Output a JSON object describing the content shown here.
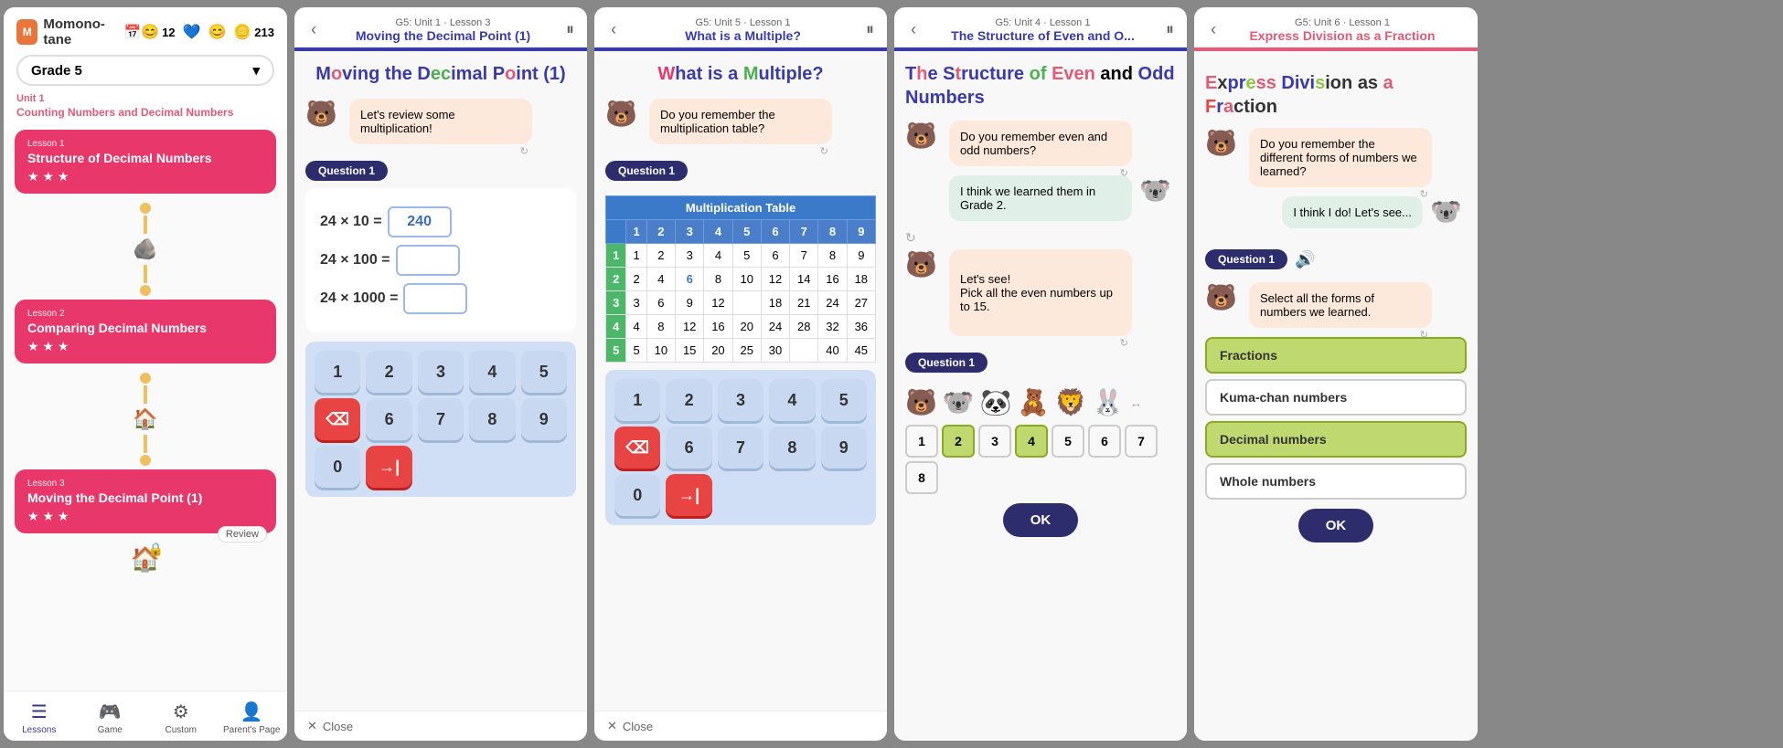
{
  "panel1": {
    "logo": "Momono-tane",
    "coins": [
      {
        "emoji": "😊",
        "value": "12"
      },
      {
        "emoji": "💙",
        "value": ""
      },
      {
        "emoji": "😊",
        "value": ""
      },
      {
        "emoji": "🌟",
        "value": "213"
      }
    ],
    "grade": "Grade 5",
    "unit_number": "Unit 1",
    "unit_title": "Counting Numbers and Decimal Numbers",
    "lessons": [
      {
        "label": "Lesson 1",
        "title": "Structure of Decimal Numbers",
        "stars": "★ ★ ★"
      },
      {
        "label": "Lesson 2",
        "title": "Comparing Decimal Numbers",
        "stars": "★ ★ ★"
      },
      {
        "label": "Lesson 3",
        "title": "Moving the Decimal Point (1)",
        "stars": "★ ★ ★"
      }
    ],
    "nav": [
      {
        "label": "Lessons",
        "icon": "☰",
        "active": true
      },
      {
        "label": "Game",
        "icon": "🎮",
        "active": false
      },
      {
        "label": "Custom",
        "icon": "⚙",
        "active": false
      },
      {
        "label": "Parent's Page",
        "icon": "👤",
        "active": false
      }
    ]
  },
  "panel2": {
    "grade_label": "G5: Unit 1 · Lesson 3",
    "lesson_title": "Moving the Decimal Point (1)",
    "main_title": "Moving the Decimal Point (1)",
    "chat_bubble": "Let's review some multiplication!",
    "question_label": "Question 1",
    "problems": [
      {
        "left": "24 × 10 =",
        "answer": "240",
        "filled": true
      },
      {
        "left": "24 × 100 =",
        "answer": "",
        "filled": false
      },
      {
        "left": "24 × 1000 =",
        "answer": "",
        "filled": false
      }
    ],
    "keyboard": [
      "1",
      "2",
      "3",
      "4",
      "5",
      "⌫",
      "6",
      "7",
      "8",
      "9",
      "0",
      "→|"
    ],
    "close_label": "Close"
  },
  "panel3": {
    "grade_label": "G5: Unit 5 · Lesson 1",
    "lesson_title": "What is a Multiple?",
    "main_title": "What is a Multiple?",
    "chat_bubble": "Do you remember the multiplication table?",
    "question_label": "Question 1",
    "table_title": "Multiplication Table",
    "table_headers": [
      "1",
      "2",
      "3",
      "4",
      "5",
      "6",
      "7",
      "8",
      "9"
    ],
    "table_rows": [
      {
        "row_num": "1",
        "cells": [
          "1",
          "2",
          "3",
          "4",
          "5",
          "6",
          "7",
          "8",
          "9"
        ]
      },
      {
        "row_num": "2",
        "cells": [
          "2",
          "4",
          "6",
          "8",
          "10",
          "12",
          "14",
          "16",
          "18"
        ]
      },
      {
        "row_num": "3",
        "cells": [
          "3",
          "6",
          "9",
          "12",
          "",
          "18",
          "21",
          "24",
          "27"
        ]
      },
      {
        "row_num": "4",
        "cells": [
          "4",
          "8",
          "12",
          "16",
          "20",
          "24",
          "28",
          "32",
          "36"
        ]
      },
      {
        "row_num": "5",
        "cells": [
          "5",
          "10",
          "15",
          "20",
          "25",
          "30",
          "",
          "40",
          "45"
        ]
      }
    ],
    "keyboard": [
      "1",
      "2",
      "3",
      "4",
      "5",
      "⌫",
      "6",
      "7",
      "8",
      "9",
      "0",
      "→|"
    ],
    "close_label": "Close"
  },
  "panel4": {
    "grade_label": "G5: Unit 4 · Lesson 1",
    "lesson_title": "The Structure of Even and O...",
    "main_title": "The Structure of Even and Odd Numbers",
    "chat1": "Do you remember even and odd numbers?",
    "chat2": "I think we learned them in Grade 2.",
    "chat3": "Let's see!\nPick all the even numbers up to 15.",
    "question_label": "Question 1",
    "numbers": [
      "1",
      "2",
      "3",
      "4",
      "5",
      "6",
      "7",
      "8"
    ],
    "selected_numbers": [
      2,
      4
    ],
    "ok_label": "OK"
  },
  "panel5": {
    "grade_label": "G5: Unit 6 · Lesson 1",
    "lesson_title": "Express Division as a Fraction",
    "main_title": "Express Division as a Fraction",
    "chat1": "Do you remember the different forms of numbers we learned?",
    "chat2": "I think I do! Let's see...",
    "question_label": "Question 1",
    "question_text": "Select all the forms of numbers we learned.",
    "choices": [
      {
        "label": "Fractions",
        "selected": true
      },
      {
        "label": "Kuma-chan numbers",
        "selected": false
      },
      {
        "label": "Decimal numbers",
        "selected": true
      },
      {
        "label": "Whole numbers",
        "selected": false
      }
    ],
    "ok_label": "OK"
  }
}
